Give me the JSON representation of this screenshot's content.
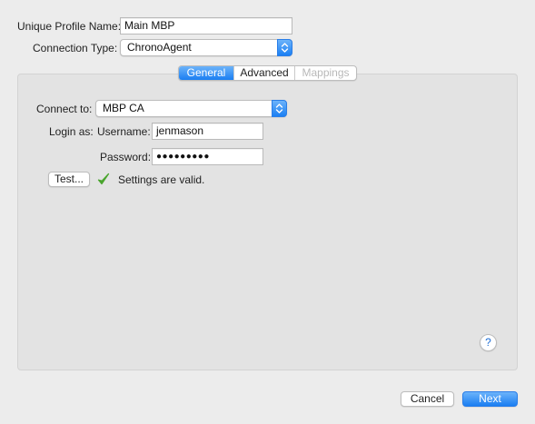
{
  "profile": {
    "name_label": "Unique Profile Name:",
    "name_value": "Main MBP",
    "connection_label": "Connection Type:",
    "connection_value": "ChronoAgent"
  },
  "tabs": [
    {
      "label": "General",
      "state": "selected"
    },
    {
      "label": "Advanced",
      "state": "normal"
    },
    {
      "label": "Mappings",
      "state": "disabled"
    }
  ],
  "general": {
    "connect_label": "Connect to:",
    "connect_value": "MBP CA",
    "login_label": "Login as:",
    "username_label": "Username:",
    "username_value": "jenmason",
    "password_label": "Password:",
    "password_value": "●●●●●●●●●",
    "test_button": "Test...",
    "status_text": "Settings are valid.",
    "status_color": "#4aa52e"
  },
  "footer": {
    "help_label": "?",
    "cancel_label": "Cancel",
    "next_label": "Next"
  },
  "colors": {
    "accent": "#1a7ef2",
    "window_bg": "#ececec",
    "panel_bg": "#e3e3e3"
  }
}
